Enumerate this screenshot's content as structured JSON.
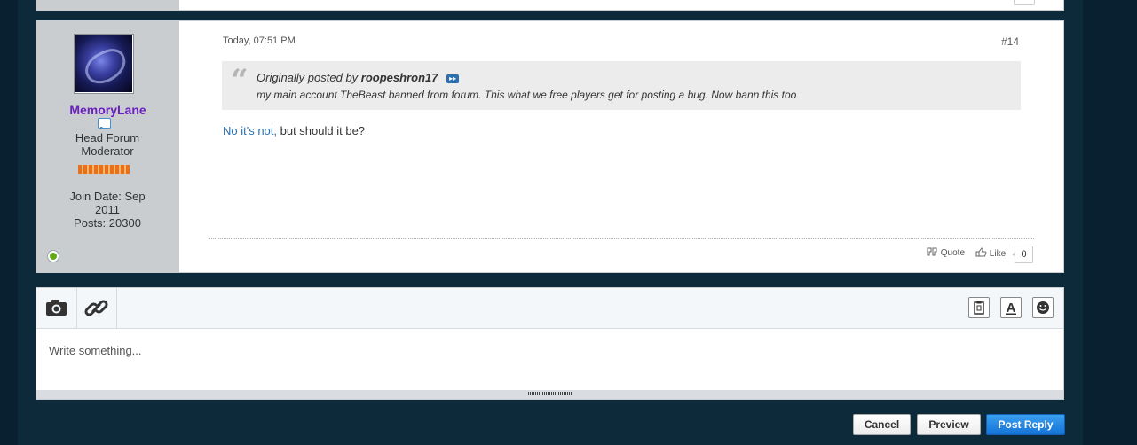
{
  "post": {
    "user": {
      "username": "MemoryLane",
      "title_line1": "Head Forum",
      "title_line2": "Moderator",
      "join_line1": "Join Date: Sep",
      "join_line2": "2011",
      "posts": "Posts: 20300"
    },
    "date": "Today, 07:51 PM",
    "number": "#14",
    "quote": {
      "prefix": "Originally posted by",
      "author": "roopeshron17",
      "text": "my main account TheBeast banned from forum. This what we free players get for posting a bug. Now bann this too"
    },
    "body_link": "No it's not,",
    "body_rest": " but should it be?",
    "actions": {
      "quote_label": "Quote",
      "like_label": "Like",
      "like_count": "0"
    }
  },
  "editor": {
    "placeholder": "Write something..."
  },
  "buttons": {
    "cancel": "Cancel",
    "preview": "Preview",
    "post_reply": "Post Reply"
  },
  "colors": {
    "background": "#0f2a3c",
    "username": "#6b1fbf",
    "link": "#2a6fb0",
    "primary_button": "#1573d6"
  }
}
